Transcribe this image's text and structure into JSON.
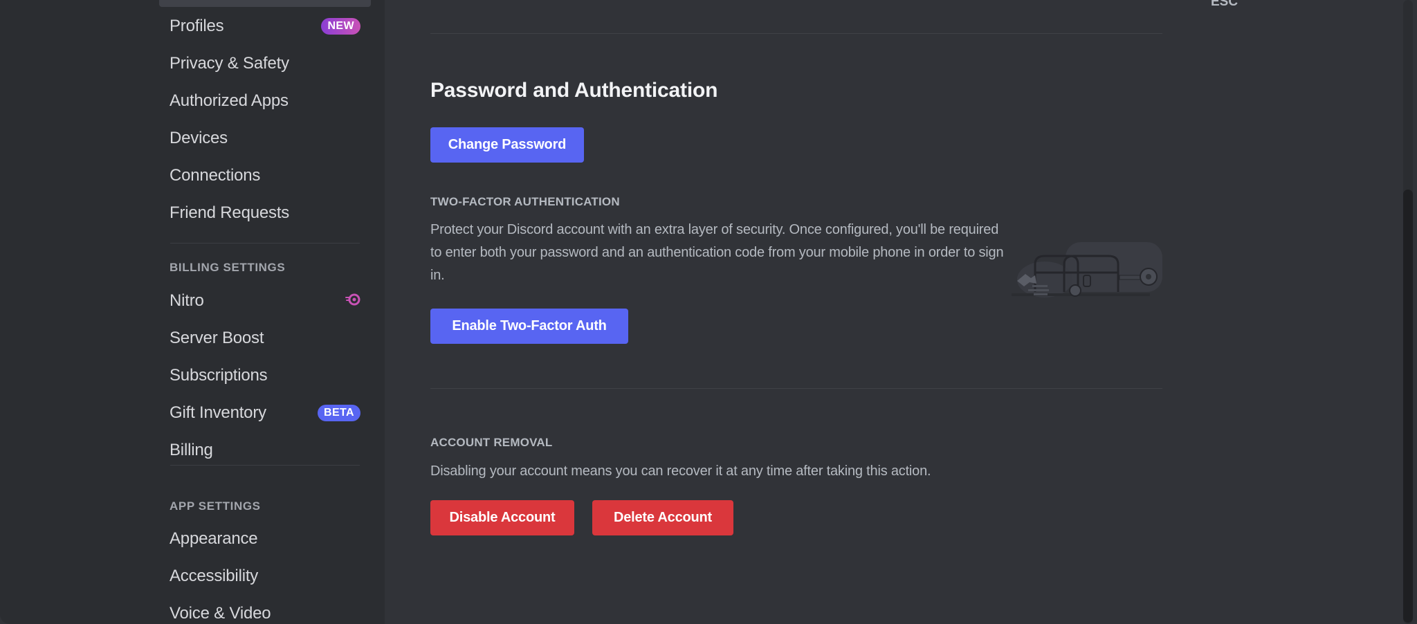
{
  "sidebar": {
    "user_settings_items": [
      {
        "label": "Profiles",
        "badge": "NEW"
      },
      {
        "label": "Privacy & Safety"
      },
      {
        "label": "Authorized Apps"
      },
      {
        "label": "Devices"
      },
      {
        "label": "Connections"
      },
      {
        "label": "Friend Requests"
      }
    ],
    "billing_header": "BILLING SETTINGS",
    "billing_items": [
      {
        "label": "Nitro",
        "icon": "nitro-icon"
      },
      {
        "label": "Server Boost"
      },
      {
        "label": "Subscriptions"
      },
      {
        "label": "Gift Inventory",
        "badge": "BETA"
      },
      {
        "label": "Billing"
      }
    ],
    "app_header": "APP SETTINGS",
    "app_items": [
      {
        "label": "Appearance"
      },
      {
        "label": "Accessibility"
      },
      {
        "label": "Voice & Video"
      }
    ]
  },
  "main": {
    "close_hint": "ESC",
    "password_section": {
      "title": "Password and Authentication",
      "change_password_label": "Change Password"
    },
    "two_factor": {
      "header": "TWO-FACTOR AUTHENTICATION",
      "description": "Protect your Discord account with an extra layer of security. Once configured, you'll be required to enter both your password and an authentication code from your mobile phone in order to sign in.",
      "enable_label": "Enable Two-Factor Auth",
      "illustration": "treasure-chest-key-illustration"
    },
    "account_removal": {
      "header": "ACCOUNT REMOVAL",
      "description": "Disabling your account means you can recover it at any time after taking this action.",
      "disable_label": "Disable Account",
      "delete_label": "Delete Account"
    }
  },
  "colors": {
    "brand": "#5865f2",
    "danger": "#da373c",
    "nitro": "#c952b6"
  }
}
